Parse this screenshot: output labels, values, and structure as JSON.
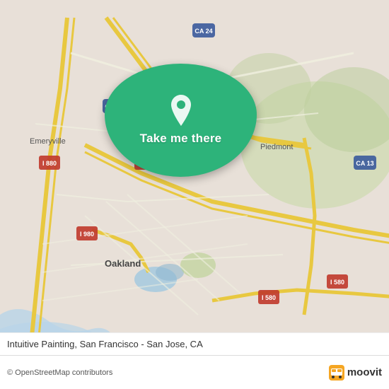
{
  "map": {
    "background_color": "#e8e0d8",
    "center": "Oakland, CA",
    "overlay_color": "#2db37a"
  },
  "action_bubble": {
    "label": "Take me there",
    "pin_color": "white"
  },
  "place": {
    "title": "Intuitive Painting, San Francisco - San Jose, CA"
  },
  "attribution": {
    "text": "© OpenStreetMap contributors"
  },
  "moovit": {
    "text": "moovit"
  },
  "labels": {
    "emeryville": "Emeryville",
    "oakland": "Oakland",
    "piedmont": "Piedmont",
    "ca24": "CA 24",
    "ca13": "CA 13",
    "i580": "I 580",
    "i880": "I 880",
    "i980": "I 980"
  }
}
